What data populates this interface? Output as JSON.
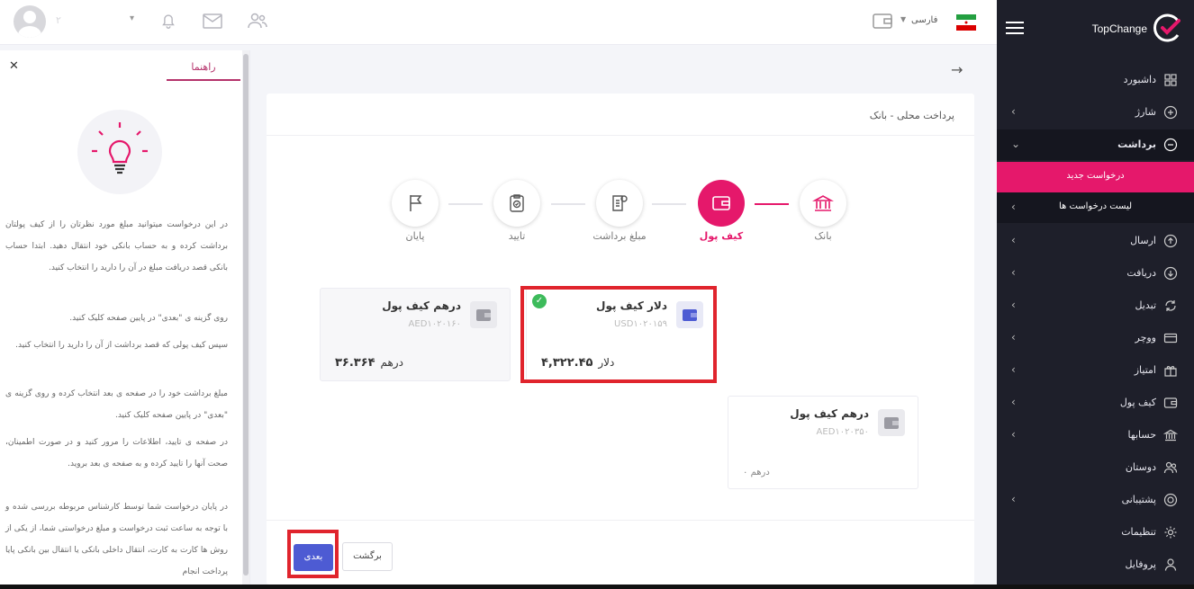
{
  "sidebar": {
    "brand": "TopChange",
    "items": [
      {
        "label": "داشبورد",
        "icon": "dashboard-icon",
        "chevron": false
      },
      {
        "label": "شارژ",
        "icon": "plus-circle-icon",
        "chevron": true
      },
      {
        "label": "برداشت",
        "icon": "minus-circle-icon",
        "chevron": true,
        "expanded": true
      },
      {
        "label": "ارسال",
        "icon": "arrow-up-circle-icon",
        "chevron": true
      },
      {
        "label": "دریافت",
        "icon": "arrow-down-circle-icon",
        "chevron": true
      },
      {
        "label": "تبدیل",
        "icon": "exchange-icon",
        "chevron": true
      },
      {
        "label": "ووچر",
        "icon": "voucher-icon",
        "chevron": true
      },
      {
        "label": "امتیاز",
        "icon": "gift-icon",
        "chevron": true
      },
      {
        "label": "کیف پول",
        "icon": "wallet-icon",
        "chevron": true
      },
      {
        "label": "حسابها",
        "icon": "bank-icon",
        "chevron": true
      },
      {
        "label": "دوستان",
        "icon": "friends-icon",
        "chevron": false
      },
      {
        "label": "پشتیبانی",
        "icon": "support-icon",
        "chevron": true
      },
      {
        "label": "تنظیمات",
        "icon": "settings-icon",
        "chevron": false
      },
      {
        "label": "پروفایل",
        "icon": "profile-icon",
        "chevron": false
      }
    ],
    "submenu": [
      {
        "label": "درخواست جدید",
        "selected": true
      },
      {
        "label": "لیست درخواست ها",
        "selected": false
      }
    ]
  },
  "topbar": {
    "user_name": "۲",
    "language": "فارسی"
  },
  "help": {
    "tab_label": "راهنما",
    "intro": "در این درخواست میتوانید مبلغ مورد نظرتان را از کیف پولتان برداشت کرده و به حساب بانکی خود انتقال دهید. ابتدا حساب بانکی قصد دریافت مبلغ در آن را دارید را انتخاب کنید.",
    "bullets": [
      "روی گزینه ی \"بعدی\" در پایین صفحه کلیک کنید.",
      "سپس کیف پولی که قصد برداشت از آن را دارید را انتخاب کنید.",
      "مبلغ برداشت خود را در صفحه ی بعد انتخاب کرده و روی گزینه ی \"بعدی\" در پایین صفحه کلیک کنید.",
      "در صفحه ی تایید، اطلاعات را مرور کنید و در صورت اطمینان، صحت آنها را تایید کرده و به صفحه ی بعد بروید.",
      "در پایان درخواست شما توسط کارشناس مربوطه بررسی شده و با توجه به ساعت ثبت درخواست و مبلغ درخواستی شما، از یکی از روش ها کارت به کارت، انتقال داخلی بانکی یا انتقال بین بانکی پایا پرداخت انجام"
    ]
  },
  "page": {
    "title": "پرداخت محلی - بانک",
    "steps": [
      {
        "label": "بانک",
        "icon": "bank-icon",
        "state": "done"
      },
      {
        "label": "کیف پول",
        "icon": "wallet-icon",
        "state": "active"
      },
      {
        "label": "مبلغ برداشت",
        "icon": "money-icon",
        "state": "pending"
      },
      {
        "label": "تایید",
        "icon": "clipboard-check-icon",
        "state": "pending"
      },
      {
        "label": "پایان",
        "icon": "flag-icon",
        "state": "pending"
      }
    ],
    "wallets": [
      {
        "name": "دلار کیف پول",
        "code": "USD۱۰۲۰۱۵۹",
        "amount": "۴,۳۲۲.۴۵",
        "currency": "دلار",
        "selected": true
      },
      {
        "name": "درهم کیف پول",
        "code": "AED۱۰۲۰۱۶۰",
        "amount": "۳۶.۳۶۴",
        "currency": "درهم",
        "selected": false
      },
      {
        "name": "درهم کیف پول",
        "code": "AED۱۰۲۰۳۵۰",
        "amount": "۰",
        "currency": "درهم",
        "selected": false
      }
    ],
    "buttons": {
      "next": "بعدی",
      "back": "برگشت"
    }
  },
  "colors": {
    "accent": "#e5186b",
    "primary_button": "#4d5bd3",
    "sidebar_bg": "#1e1f2a",
    "highlight": "#e0242d",
    "success": "#3dbb5b"
  }
}
